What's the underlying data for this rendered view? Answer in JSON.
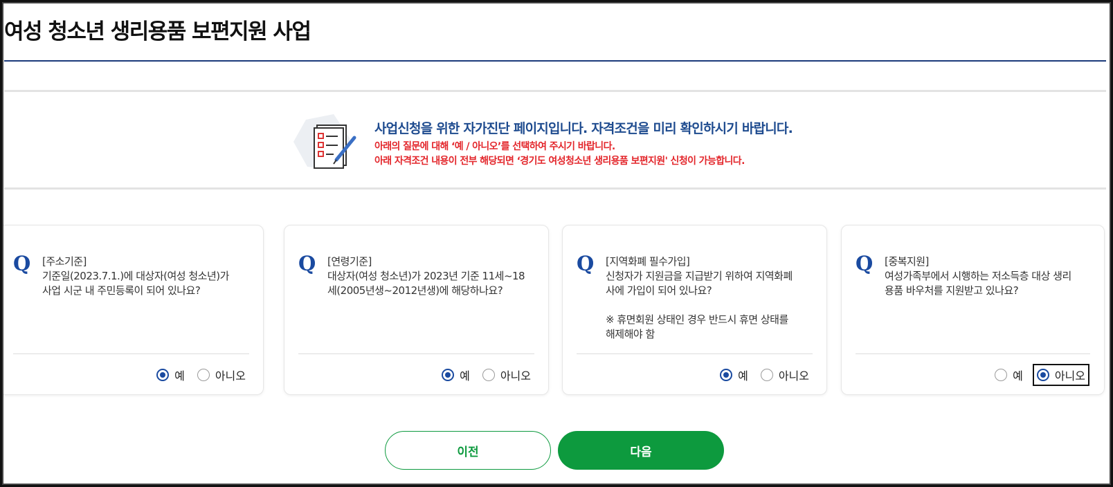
{
  "page": {
    "title": "여성 청소년 생리용품 보편지원 사업"
  },
  "notice": {
    "icon": "checklist-pen-icon",
    "main": "사업신청을 위한 자가진단 페이지입니다. 자격조건을 미리 확인하시기 바랍니다.",
    "line1": "아래의 질문에 대해 ‘예 / 아니오’를 선택하여 주시기 바랍니다.",
    "line2": "아래 자격조건 내용이 전부 해당되면 ‘경기도 여성청소년 생리용품 보편지원' 신청이 가능합니다."
  },
  "questions": [
    {
      "mark": "Q",
      "text": "[주소기준]\n기준일(2023.7.1.)에 대상자(여성 청소년)가\n사업 시군 내 주민등록이 되어 있나요?",
      "yes": "예",
      "no": "아니오",
      "selected": "예"
    },
    {
      "mark": "Q",
      "text": "[연령기준]\n대상자(여성 청소년)가 2023년 기준 11세~18\n세(2005년생~2012년생)에 해당하나요?",
      "yes": "예",
      "no": "아니오",
      "selected": "예"
    },
    {
      "mark": "Q",
      "text": "[지역화폐 필수가입]\n신청자가 지원금을 지급받기 위하여 지역화폐\n사에 가입이 되어 있나요?\n\n※ 휴면회원 상태인 경우 반드시 휴면 상태를\n해제해야 함",
      "yes": "예",
      "no": "아니오",
      "selected": "예"
    },
    {
      "mark": "Q",
      "text": "[중복지원]\n여성가족부에서 시행하는 저소득층 대상 생리\n용품 바우처를 지원받고 있나요?",
      "yes": "예",
      "no": "아니오",
      "selected": "아니오"
    }
  ],
  "buttons": {
    "prev": "이전",
    "next": "다음"
  },
  "colors": {
    "primary_blue": "#1a4aa0",
    "notice_red": "#e3262b",
    "green": "#0d9a3e"
  }
}
